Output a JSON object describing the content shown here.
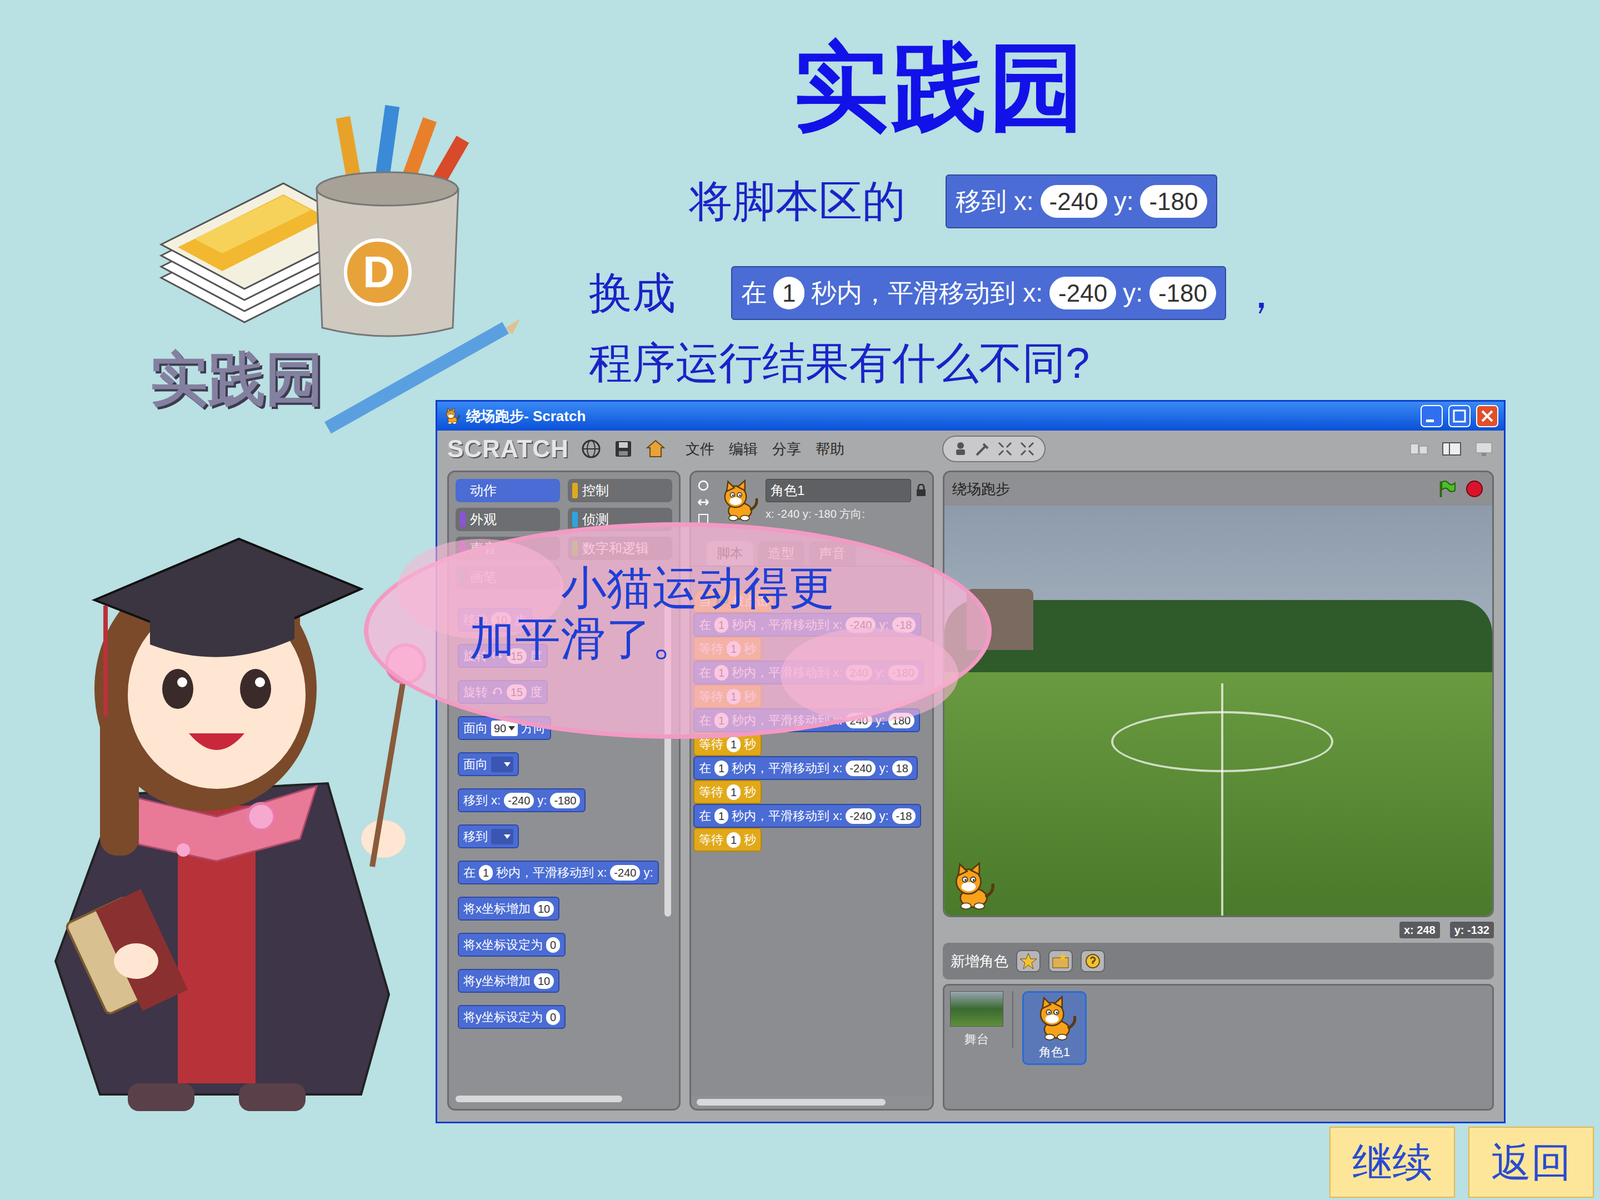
{
  "slide": {
    "title": "实践园",
    "logo_text": "实践园",
    "cup_letter": "D",
    "prompt": {
      "line1": "将脚本区的",
      "block1": {
        "kind": "motion",
        "parts": [
          {
            "type": "text",
            "text": "移到 x:"
          },
          {
            "type": "num",
            "text": "-240"
          },
          {
            "type": "text",
            "text": "y:"
          },
          {
            "type": "num",
            "text": "-180"
          }
        ]
      },
      "line2": "换成",
      "block2": {
        "kind": "motion",
        "parts": [
          {
            "type": "text",
            "text": "在"
          },
          {
            "type": "num",
            "text": "1"
          },
          {
            "type": "text",
            "text": "秒内，平滑移动到 x:"
          },
          {
            "type": "num",
            "text": "-240"
          },
          {
            "type": "text",
            "text": "y:"
          },
          {
            "type": "num",
            "text": "-180"
          }
        ]
      },
      "comma": "，",
      "line3": "程序运行结果有什么不同?"
    },
    "bubble": {
      "lines": [
        "小猫运动得更",
        "加平滑了。"
      ]
    },
    "nav": [
      {
        "label": "继续"
      },
      {
        "label": "返回"
      }
    ]
  },
  "window": {
    "title": "绕场跑步- Scratch"
  },
  "toolbar": {
    "logo": "SCRATCH",
    "menu": [
      "文件",
      "编辑",
      "分享",
      "帮助"
    ]
  },
  "categories": [
    {
      "label": "动作",
      "color": "#4a6cd4",
      "selected": true
    },
    {
      "label": "控制",
      "color": "#e1a91a",
      "selected": false
    },
    {
      "label": "外观",
      "color": "#8a55d7",
      "selected": false
    },
    {
      "label": "侦测",
      "color": "#2ca5e2",
      "selected": false
    },
    {
      "label": "声音",
      "color": "#bb42c3",
      "selected": false
    },
    {
      "label": "数字和逻辑",
      "color": "#5cb712",
      "selected": false
    },
    {
      "label": "画笔",
      "color": "#0e9a6c",
      "selected": false
    }
  ],
  "palette": [
    {
      "kind": "motion",
      "parts": [
        {
          "type": "text",
          "text": "移动"
        },
        {
          "type": "num",
          "text": "10"
        },
        {
          "type": "text",
          "text": "步"
        }
      ]
    },
    {
      "kind": "motion",
      "parts": [
        {
          "type": "text",
          "text": "旋转"
        },
        {
          "type": "rot-cw"
        },
        {
          "type": "num",
          "text": "15"
        },
        {
          "type": "text",
          "text": "度"
        }
      ]
    },
    {
      "kind": "motion",
      "parts": [
        {
          "type": "text",
          "text": "旋转"
        },
        {
          "type": "rot-ccw"
        },
        {
          "type": "num",
          "text": "15"
        },
        {
          "type": "text",
          "text": "度"
        }
      ]
    },
    {
      "kind": "motion",
      "parts": [
        {
          "type": "text",
          "text": "面向"
        },
        {
          "type": "drop",
          "text": "90"
        },
        {
          "type": "text",
          "text": "方向"
        }
      ]
    },
    {
      "kind": "motion",
      "parts": [
        {
          "type": "text",
          "text": "面向"
        },
        {
          "type": "drop-empty"
        }
      ]
    },
    {
      "kind": "motion",
      "parts": [
        {
          "type": "text",
          "text": "移到 x:"
        },
        {
          "type": "num",
          "text": "-240"
        },
        {
          "type": "text",
          "text": "y:"
        },
        {
          "type": "num",
          "text": "-180"
        }
      ]
    },
    {
      "kind": "motion",
      "parts": [
        {
          "type": "text",
          "text": "移到"
        },
        {
          "type": "drop-empty"
        }
      ]
    },
    {
      "kind": "motion",
      "parts": [
        {
          "type": "text",
          "text": "在"
        },
        {
          "type": "num",
          "text": "1"
        },
        {
          "type": "text",
          "text": "秒内，平滑移动到 x:"
        },
        {
          "type": "num",
          "text": "-240"
        },
        {
          "type": "text",
          "text": "y:"
        }
      ]
    },
    {
      "kind": "motion",
      "parts": [
        {
          "type": "text",
          "text": "将x坐标增加"
        },
        {
          "type": "num",
          "text": "10"
        }
      ]
    },
    {
      "kind": "motion",
      "parts": [
        {
          "type": "text",
          "text": "将x坐标设定为"
        },
        {
          "type": "num",
          "text": "0"
        }
      ]
    },
    {
      "kind": "motion",
      "parts": [
        {
          "type": "text",
          "text": "将y坐标增加"
        },
        {
          "type": "num",
          "text": "10"
        }
      ]
    },
    {
      "kind": "motion",
      "parts": [
        {
          "type": "text",
          "text": "将y坐标设定为"
        },
        {
          "type": "num",
          "text": "0"
        }
      ]
    }
  ],
  "sprite": {
    "name": "角色1",
    "info": "x: -240 y: -180 方向:"
  },
  "script_tabs": [
    {
      "label": "脚本",
      "selected": true
    },
    {
      "label": "造型",
      "selected": false
    },
    {
      "label": "声音",
      "selected": false
    }
  ],
  "script": [
    {
      "kind": "hat",
      "parts": [
        {
          "type": "text",
          "text": "当"
        },
        {
          "type": "flag"
        },
        {
          "type": "text",
          "text": "被点击"
        }
      ]
    },
    {
      "kind": "motion",
      "parts": [
        {
          "type": "text",
          "text": "在"
        },
        {
          "type": "num",
          "text": "1"
        },
        {
          "type": "text",
          "text": "秒内，平滑移动到 x:"
        },
        {
          "type": "num",
          "text": "-240"
        },
        {
          "type": "text",
          "text": "y:"
        },
        {
          "type": "num",
          "text": "-18"
        }
      ]
    },
    {
      "kind": "control",
      "parts": [
        {
          "type": "text",
          "text": "等待"
        },
        {
          "type": "num",
          "text": "1"
        },
        {
          "type": "text",
          "text": "秒"
        }
      ]
    },
    {
      "kind": "motion",
      "parts": [
        {
          "type": "text",
          "text": "在"
        },
        {
          "type": "num",
          "text": "1"
        },
        {
          "type": "text",
          "text": "秒内，平滑移动到 x:"
        },
        {
          "type": "num",
          "text": "240"
        },
        {
          "type": "text",
          "text": "y:"
        },
        {
          "type": "num",
          "text": "-180"
        }
      ]
    },
    {
      "kind": "control",
      "parts": [
        {
          "type": "text",
          "text": "等待"
        },
        {
          "type": "num",
          "text": "1"
        },
        {
          "type": "text",
          "text": "秒"
        }
      ]
    },
    {
      "kind": "motion",
      "parts": [
        {
          "type": "text",
          "text": "在"
        },
        {
          "type": "num",
          "text": "1"
        },
        {
          "type": "text",
          "text": "秒内，平滑移动到 x:"
        },
        {
          "type": "num",
          "text": "240"
        },
        {
          "type": "text",
          "text": "y:"
        },
        {
          "type": "num",
          "text": "180"
        }
      ]
    },
    {
      "kind": "control",
      "parts": [
        {
          "type": "text",
          "text": "等待"
        },
        {
          "type": "num",
          "text": "1"
        },
        {
          "type": "text",
          "text": "秒"
        }
      ]
    },
    {
      "kind": "motion",
      "parts": [
        {
          "type": "text",
          "text": "在"
        },
        {
          "type": "num",
          "text": "1"
        },
        {
          "type": "text",
          "text": "秒内，平滑移动到 x:"
        },
        {
          "type": "num",
          "text": "-240"
        },
        {
          "type": "text",
          "text": "y:"
        },
        {
          "type": "num",
          "text": "18"
        }
      ]
    },
    {
      "kind": "control",
      "parts": [
        {
          "type": "text",
          "text": "等待"
        },
        {
          "type": "num",
          "text": "1"
        },
        {
          "type": "text",
          "text": "秒"
        }
      ]
    },
    {
      "kind": "motion",
      "parts": [
        {
          "type": "text",
          "text": "在"
        },
        {
          "type": "num",
          "text": "1"
        },
        {
          "type": "text",
          "text": "秒内，平滑移动到 x:"
        },
        {
          "type": "num",
          "text": "-240"
        },
        {
          "type": "text",
          "text": "y:"
        },
        {
          "type": "num",
          "text": "-18"
        }
      ]
    },
    {
      "kind": "control",
      "parts": [
        {
          "type": "text",
          "text": "等待"
        },
        {
          "type": "num",
          "text": "1"
        },
        {
          "type": "text",
          "text": "秒"
        }
      ]
    }
  ],
  "stage": {
    "title": "绕场跑步",
    "mouse_x": "x: 248",
    "mouse_y": "y: -132"
  },
  "new_sprite": {
    "label": "新增角色"
  },
  "sprites": [
    {
      "label": "舞台",
      "selected": false
    },
    {
      "label": "角色1",
      "selected": true
    }
  ]
}
